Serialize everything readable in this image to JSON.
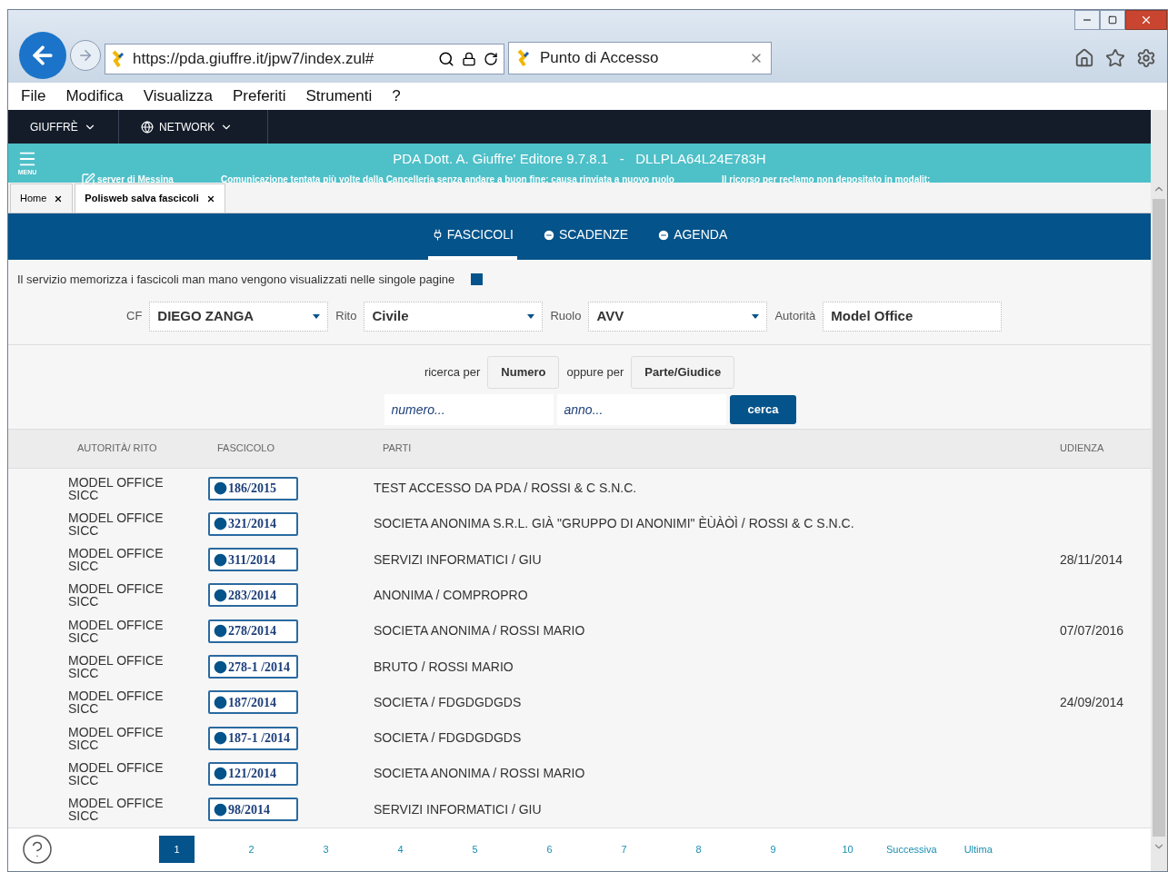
{
  "browser": {
    "address": "https://pda.giuffre.it/jpw7/index.zul#",
    "tab_title": "Punto di Accesso"
  },
  "menu": [
    "File",
    "Modifica",
    "Visualizza",
    "Preferiti",
    "Strumenti",
    "?"
  ],
  "top_nav": [
    {
      "label": "GIUFFRÈ"
    },
    {
      "label": "NETWORK"
    }
  ],
  "banner": {
    "menu_label": "MENU",
    "title": "PDA Dott. A. Giuffre' Editore 9.7.8.1   -   DLLPLA64L24E783H",
    "ticker": [
      "server di Messina",
      "Comunicazione tentata più volte dalla Cancelleria senza andare a buon fine: causa rinviata a nuovo ruolo",
      "Il ricorso per reclamo non depositato in modalit:"
    ]
  },
  "app_tabs": [
    {
      "label": "Home",
      "selected": false
    },
    {
      "label": "Polisweb salva fascicoli",
      "selected": true
    }
  ],
  "section_tabs": [
    {
      "label": "FASCICOLI",
      "selected": true
    },
    {
      "label": "SCADENZE",
      "selected": false
    },
    {
      "label": "AGENDA",
      "selected": false
    }
  ],
  "info": "Il servizio memorizza i fascicoli man mano vengono visualizzati nelle singole pagine",
  "filters": [
    {
      "label": "CF",
      "value": "DIEGO ZANGA",
      "kind": "dropdown"
    },
    {
      "label": "Rito",
      "value": "Civile",
      "kind": "dropdown"
    },
    {
      "label": "Ruolo",
      "value": "AVV",
      "kind": "dropdown"
    },
    {
      "label": "Autorità",
      "value": "Model Office",
      "kind": "text"
    }
  ],
  "search": {
    "search_by_label": "ricerca per",
    "mode_1": "Numero",
    "or_label": "oppure per",
    "mode_2": "Parte/Giudice",
    "number_placeholder": "numero...",
    "year_placeholder": "anno...",
    "submit": "cerca"
  },
  "table": {
    "columns": [
      "AUTORITÀ/ RITO",
      "FASCICOLO",
      "PARTI",
      "UDIENZA"
    ],
    "rows": [
      {
        "authority": "MODEL OFFICE",
        "rito": "SICC",
        "fascicolo": "186/2015",
        "parti": "TEST ACCESSO DA PDA / ROSSI & C S.N.C.",
        "udienza": ""
      },
      {
        "authority": "MODEL OFFICE",
        "rito": "SICC",
        "fascicolo": "321/2014",
        "parti": "SOCIETA ANONIMA S.R.L. GIÀ \"GRUPPO DI ANONIMI\" ÈÙÀÒÌ / ROSSI & C S.N.C.",
        "udienza": ""
      },
      {
        "authority": "MODEL OFFICE",
        "rito": "SICC",
        "fascicolo": "311/2014",
        "parti": "SERVIZI INFORMATICI / GIU",
        "udienza": "28/11/2014"
      },
      {
        "authority": "MODEL OFFICE",
        "rito": "SICC",
        "fascicolo": "283/2014",
        "parti": "ANONIMA / COMPROPRO",
        "udienza": ""
      },
      {
        "authority": "MODEL OFFICE",
        "rito": "SICC",
        "fascicolo": "278/2014",
        "parti": "SOCIETA ANONIMA / ROSSI MARIO",
        "udienza": "07/07/2016"
      },
      {
        "authority": "MODEL OFFICE",
        "rito": "SICC",
        "fascicolo": "278-1 /2014",
        "parti": "BRUTO / ROSSI MARIO",
        "udienza": ""
      },
      {
        "authority": "MODEL OFFICE",
        "rito": "SICC",
        "fascicolo": "187/2014",
        "parti": "SOCIETA / FDGDGDGDS",
        "udienza": "24/09/2014"
      },
      {
        "authority": "MODEL OFFICE",
        "rito": "SICC",
        "fascicolo": "187-1 /2014",
        "parti": "SOCIETA / FDGDGDGDS",
        "udienza": ""
      },
      {
        "authority": "MODEL OFFICE",
        "rito": "SICC",
        "fascicolo": "121/2014",
        "parti": "SOCIETA ANONIMA / ROSSI MARIO",
        "udienza": ""
      },
      {
        "authority": "MODEL OFFICE",
        "rito": "SICC",
        "fascicolo": "98/2014",
        "parti": "SERVIZI INFORMATICI / GIU",
        "udienza": ""
      }
    ]
  },
  "pagination": {
    "pages": [
      {
        "label": "1",
        "selected": true
      },
      {
        "label": "2",
        "selected": false
      },
      {
        "label": "3",
        "selected": false
      },
      {
        "label": "4",
        "selected": false
      },
      {
        "label": "5",
        "selected": false
      },
      {
        "label": "6",
        "selected": false
      },
      {
        "label": "7",
        "selected": false
      },
      {
        "label": "8",
        "selected": false
      },
      {
        "label": "9",
        "selected": false
      },
      {
        "label": "10",
        "selected": false
      }
    ],
    "next": "Successiva",
    "last": "Ultima"
  }
}
